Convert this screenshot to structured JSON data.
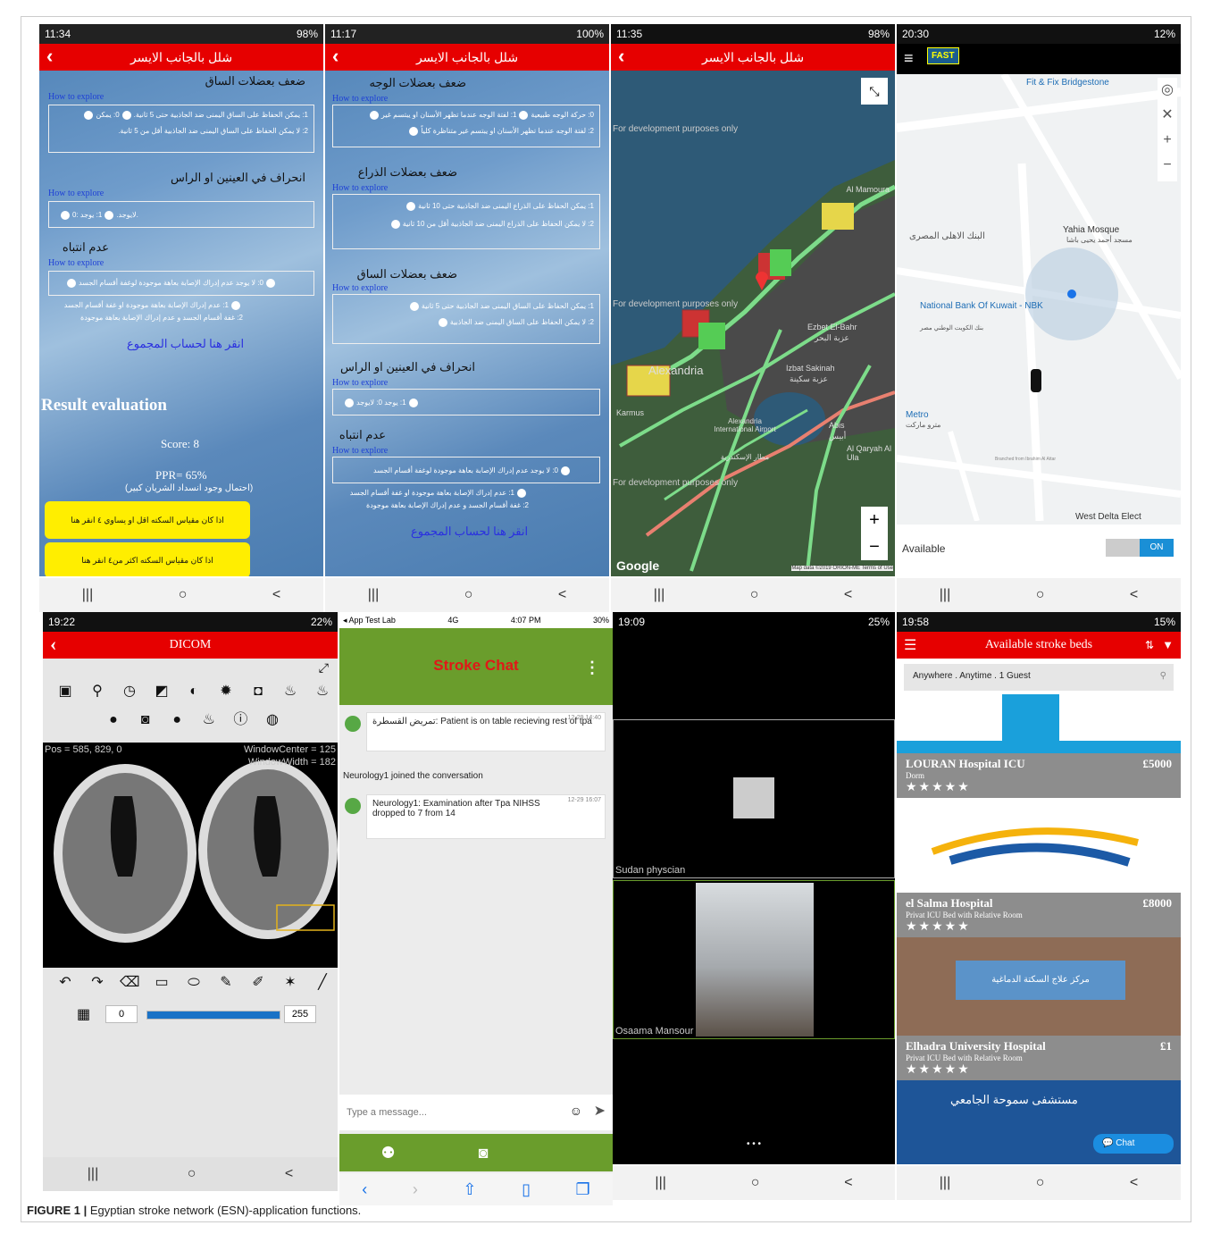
{
  "panels": {
    "p1": {
      "time": "11:34",
      "battery": "98%",
      "title": "شلل بالجانب الايسر",
      "sec1": "ضعف بعضلات الساق",
      "how": "How to explore",
      "s1o1": "1: يمكن الحفاظ على الساق اليمنى ضد الجاذبية حتى 5 ثانية.",
      "s1o0": "0: يمكن",
      "s1o2": "2: لا يمكن الحفاظ على الساق اليمنى ضد الجاذبية أقل من 5 ثانية.",
      "sec2": "انحراف في العينين او الراس",
      "s2o1": "1: يوجد.",
      "s2o0": "0: لايوجد.",
      "sec3": "عدم انتباه",
      "s3o0": "0: لا يوجد عدم إدراك الإصابة بعاهة موجودة لوغفة أقسام الجسد",
      "s3o1": "1: عدم إدراك الإصابة بعاهة موجودة او غفة أقسام الجسد",
      "s3o2": "2: غفة أقسام الجسد و عدم إدراك الإصابة بعاهة موجودة",
      "link": "انقر هنا لحساب المجموع",
      "result": "Result evaluation",
      "score": "Score: 8",
      "ppr": "PPR= 65%",
      "ppr_note": "(احتمال وجود انسداد الشريان كبير)",
      "btn1": "اذا كان مقياس السكته اقل او يساوي ٤ انقر هنا",
      "btn2": "اذا كان مقياس السكته اكثر من٤ انقر هنا"
    },
    "p2": {
      "time": "11:17",
      "battery": "100%",
      "title": "شلل بالجانب الايسر",
      "sec1": "ضعف بعضلات الوجه",
      "s1o1": "1: لفتة الوجه عندما تظهر الأسنان او يبتسم غير",
      "s1o2": "2: لفتة الوجه عندما تظهر الأسنان او يبتسم غير متناظرة كلياً",
      "s1o0": "0: حركة الوجه طبيعية",
      "sec2": "ضعف بعضلات الذراع",
      "s2o1": "1: يمكن الحفاظ على الذراع اليمنى ضد الجاذبية حتى 10 ثانية",
      "s2o2": "2: لا يمكن الحفاظ على الذراع اليمنى ضد الجاذبية أقل من 10 ثانية",
      "sec3": "ضعف بعضلات الساق",
      "s3o1": "1: يمكن الحفاظ على الساق اليمنى ضد الجاذبية حتى 5 ثانية",
      "s3o2": "2: لا يمكن الحفاظ على الساق اليمنى ضد الجاذبية",
      "sec4": "انحراف في العينين او الراس",
      "s4o": "1: يوجد   0: لايوجد",
      "sec5": "عدم انتباه",
      "s5o0": "0: لا يوجد عدم إدراك الإصابة بعاهة موجودة لوغفة أقسام الجسد",
      "s5o1": "1: عدم إدراك الإصابة بعاهة موجودة او غفة أقسام الجسد",
      "s5o2": "2: غفة أقسام الجسد و عدم إدراك الإصابة بعاهة موجودة",
      "link": "انقر هنا لحساب المجموع"
    },
    "p3": {
      "time": "11:35",
      "battery": "98%",
      "title": "شلل بالجانب الايسر",
      "dev": "For development purposes only",
      "places": [
        "Al Mamoura",
        "Ezbet El-Bahr",
        "عزبة البحر",
        "Izbat Sakinah",
        "عزبة سكينة",
        "Alexandria International Airport",
        "مطار الإسكندرية",
        "Abis",
        "أبيس",
        "Al Qaryah Al Ula",
        "Karmus",
        "Alexandria"
      ],
      "google": "Google",
      "credit": "Map data ©2019 ORION-ME  Terms of Use",
      "plus": "+",
      "minus": "−"
    },
    "p4": {
      "time": "20:30",
      "battery": "12%",
      "logo": "FAST",
      "places": [
        "Fit & Fix Bridgestone",
        "Yahia Mosque",
        "مسجد أحمد يحيى باشا",
        "البنك الاهلى المصرى",
        "National Bank Of Kuwait - NBK",
        "بنك الكويت الوطني مصر",
        "Metro",
        "مترو ماركت",
        "West Delta Elect",
        "Branched from Ibrahim Al Attar"
      ],
      "available": "Available",
      "toggle": "ON",
      "plus": "+",
      "minus": "−"
    },
    "p5": {
      "time": "19:22",
      "battery": "22%",
      "title": "DICOM",
      "pos": "Pos = 585, 829, 0",
      "wc": "WindowCenter = 125",
      "ww": "WindowWidth = 182",
      "min": "0",
      "max": "255"
    },
    "p6": {
      "carrier": "◂ App Test Lab",
      "net": "4G",
      "time": "4:07 PM",
      "battery": "30%",
      "title": "Stroke Chat",
      "m1_sender": "تمريض القسطرة:",
      "m1_text": "Patient is on table recieving rest of tpa",
      "m1_time": "12-29 14:40",
      "joined": "Neurology1 joined the conversation",
      "m2_sender": "Neurology1:",
      "m2_text": "Examination after Tpa NIHSS dropped to 7 from 14",
      "m2_time": "12-29 16:07",
      "placeholder": "Type a message..."
    },
    "p7": {
      "time": "19:09",
      "battery": "25%",
      "name1": "Sudan physcian",
      "name2": "Osaama Mansour",
      "dots": "• • •"
    },
    "p8": {
      "time": "19:58",
      "battery": "15%",
      "title": "Available stroke beds",
      "search": "Anywhere . Anytime . 1 Guest",
      "beds": [
        {
          "name": "LOURAN Hospital ICU",
          "price": "£5000",
          "type": "Dorm",
          "stars": "★★★★★"
        },
        {
          "name": "el Salma Hospital",
          "price": "£8000",
          "type": "Privat ICU Bed with Relative Room",
          "stars": "★★★★★"
        },
        {
          "name": "Elhadra University Hospital",
          "price": "£1",
          "type": "Privat ICU Bed with Relative Room",
          "stars": "★★★★★"
        }
      ],
      "sign1": "مركز علاج السكتة الدماغية",
      "sign2": "مستشفى سموحة الجامعي",
      "chat": "Chat"
    }
  },
  "nav": {
    "menu": "|||",
    "home": "○",
    "back": "<"
  },
  "caption": {
    "label": "FIGURE 1 |",
    "text": " Egyptian stroke network (ESN)-application functions."
  }
}
